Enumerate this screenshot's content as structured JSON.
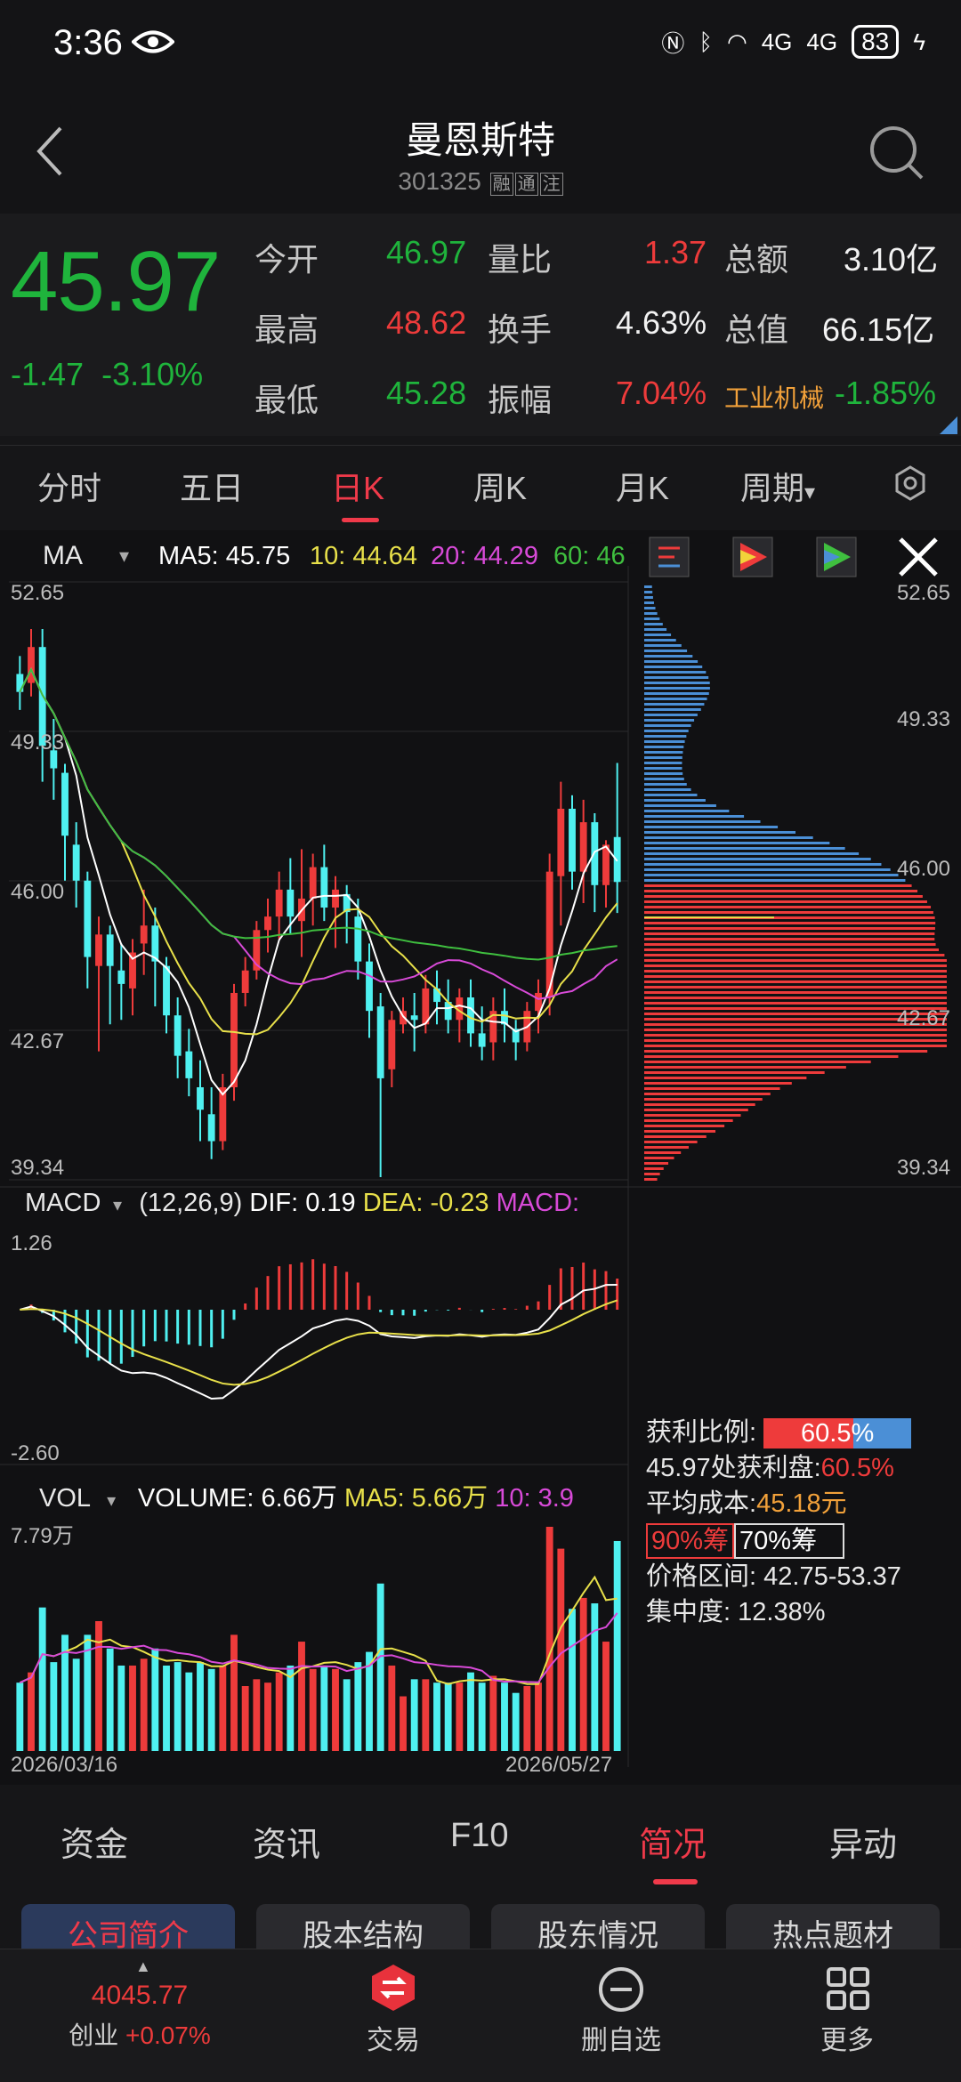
{
  "status_bar": {
    "time": "3:36",
    "net": "4G",
    "battery": "83"
  },
  "header": {
    "title": "曼恩斯特",
    "code": "301325",
    "tags": [
      "融",
      "通",
      "注"
    ]
  },
  "quote": {
    "price": "45.97",
    "change": "-1.47",
    "change_pct": "-3.10%",
    "rows": [
      [
        {
          "l": "今开",
          "v": "46.97",
          "c": "g"
        },
        {
          "l": "量比",
          "v": "1.37",
          "c": "r"
        },
        {
          "l": "总额",
          "v": "3.10亿",
          "c": "w"
        }
      ],
      [
        {
          "l": "最高",
          "v": "48.62",
          "c": "r"
        },
        {
          "l": "换手",
          "v": "4.63%",
          "c": "w"
        },
        {
          "l": "总值",
          "v": "66.15亿",
          "c": "w"
        }
      ],
      [
        {
          "l": "最低",
          "v": "45.28",
          "c": "g"
        },
        {
          "l": "振幅",
          "v": "7.04%",
          "c": "r"
        },
        {
          "l": "工业机械",
          "v": "-1.85%",
          "c": "g"
        }
      ]
    ]
  },
  "period_tabs": [
    "分时",
    "五日",
    "日K",
    "周K",
    "月K",
    "周期"
  ],
  "active_period": "日K",
  "ma_legend": {
    "name": "MA",
    "ma5": "MA5: 45.75",
    "ma10": "10: 44.64",
    "ma20": "20: 44.29",
    "ma60": "60: 46"
  },
  "price_axis": [
    "52.65",
    "49.33",
    "46.00",
    "42.67",
    "39.34"
  ],
  "macd_legend": {
    "name": "MACD",
    "params": "(12,26,9)",
    "dif": "DIF: 0.19",
    "dea": "DEA: -0.23",
    "macd": "MACD:"
  },
  "macd_axis": [
    "1.26",
    "-2.60"
  ],
  "vol_legend": {
    "name": "VOL",
    "volume": "VOLUME: 6.66万",
    "ma5": "MA5: 5.66万",
    "ma10": "10: 3.9"
  },
  "vol_axis": [
    "7.79万"
  ],
  "date_range": {
    "start": "2026/03/16",
    "end": "2026/05/27"
  },
  "chips_info": {
    "profit_ratio_label": "获利比例:",
    "profit_ratio": "60.5%",
    "profit_at_label": "45.97处获利盘:",
    "profit_at": "60.5%",
    "avg_cost_label": "平均成本:",
    "avg_cost": "45.18元",
    "btn90": "90%筹",
    "btn70": "70%筹",
    "range_label": "价格区间:",
    "range": "42.75-53.37",
    "conc_label": "集中度:",
    "conc": "12.38%"
  },
  "bottom_tabs": [
    "资金",
    "资讯",
    "F10",
    "简况",
    "异动"
  ],
  "active_bottom": "简况",
  "sub_tabs": [
    "公司简介",
    "股本结构",
    "股东情况",
    "热点题材"
  ],
  "dock": {
    "index_value": "4045.77",
    "index_name": "创业",
    "index_change": "+0.07%",
    "trade": "交易",
    "remove_fav": "删自选",
    "more": "更多"
  },
  "colors": {
    "up": "#ee3b3b",
    "down": "#4ff0f0",
    "ma5": "#ffffff",
    "ma10": "#e8e04a",
    "ma20": "#d84ad8",
    "ma60": "#3fbf3f",
    "accent": "#f03a4a"
  },
  "chart_data": {
    "type": "candlestick",
    "y_range": [
      39.34,
      52.65
    ],
    "candles": [
      [
        50.6,
        51.0,
        49.8,
        50.2
      ],
      [
        50.4,
        51.6,
        50.1,
        51.2
      ],
      [
        51.2,
        51.6,
        48.2,
        49.0
      ],
      [
        48.9,
        49.6,
        47.8,
        48.5
      ],
      [
        48.4,
        48.6,
        46.0,
        47.0
      ],
      [
        46.8,
        47.3,
        45.4,
        46.0
      ],
      [
        46.0,
        46.2,
        43.6,
        44.3
      ],
      [
        44.1,
        45.2,
        42.2,
        44.8
      ],
      [
        44.8,
        45.0,
        42.8,
        44.1
      ],
      [
        44.0,
        44.6,
        42.9,
        43.7
      ],
      [
        43.6,
        44.7,
        43.0,
        44.4
      ],
      [
        44.6,
        45.8,
        43.9,
        45.0
      ],
      [
        45.0,
        45.4,
        43.2,
        44.2
      ],
      [
        44.1,
        44.3,
        42.6,
        43.0
      ],
      [
        43.0,
        43.4,
        41.6,
        42.1
      ],
      [
        42.2,
        42.7,
        41.2,
        41.6
      ],
      [
        41.4,
        42.0,
        40.2,
        40.9
      ],
      [
        40.8,
        41.4,
        39.8,
        40.2
      ],
      [
        40.2,
        41.7,
        40.0,
        41.4
      ],
      [
        41.4,
        43.7,
        41.1,
        43.5
      ],
      [
        43.5,
        44.3,
        43.2,
        44.0
      ],
      [
        44.0,
        45.1,
        43.8,
        44.9
      ],
      [
        44.9,
        45.6,
        44.4,
        45.2
      ],
      [
        45.2,
        46.2,
        44.7,
        45.8
      ],
      [
        45.8,
        46.5,
        44.8,
        45.2
      ],
      [
        45.1,
        46.7,
        44.3,
        45.6
      ],
      [
        45.6,
        46.6,
        45.0,
        46.3
      ],
      [
        46.3,
        46.8,
        45.1,
        45.4
      ],
      [
        45.4,
        46.1,
        44.5,
        45.8
      ],
      [
        45.7,
        45.9,
        44.6,
        45.3
      ],
      [
        45.2,
        45.6,
        43.8,
        44.2
      ],
      [
        44.2,
        44.6,
        42.5,
        43.1
      ],
      [
        43.2,
        43.5,
        39.4,
        41.6
      ],
      [
        41.8,
        43.1,
        41.4,
        42.9
      ],
      [
        42.8,
        43.4,
        42.6,
        43.1
      ],
      [
        43.0,
        43.5,
        42.2,
        42.9
      ],
      [
        42.8,
        43.9,
        42.6,
        43.6
      ],
      [
        43.6,
        44.0,
        42.8,
        43.3
      ],
      [
        43.3,
        43.8,
        42.6,
        42.9
      ],
      [
        42.9,
        43.6,
        42.4,
        43.4
      ],
      [
        43.4,
        43.8,
        42.3,
        42.6
      ],
      [
        42.6,
        43.2,
        42.0,
        42.3
      ],
      [
        42.4,
        43.4,
        42.0,
        43.1
      ],
      [
        43.1,
        43.6,
        42.4,
        42.8
      ],
      [
        42.7,
        42.9,
        42.0,
        42.4
      ],
      [
        42.4,
        43.3,
        42.2,
        43.1
      ],
      [
        43.1,
        43.8,
        42.6,
        43.5
      ],
      [
        43.4,
        46.6,
        43.0,
        46.2
      ],
      [
        46.1,
        48.2,
        45.0,
        47.6
      ],
      [
        47.6,
        47.9,
        45.8,
        46.2
      ],
      [
        46.2,
        47.8,
        45.5,
        47.3
      ],
      [
        47.3,
        47.5,
        45.3,
        45.9
      ],
      [
        45.9,
        46.9,
        45.4,
        46.8
      ],
      [
        46.97,
        48.62,
        45.28,
        45.97
      ]
    ]
  }
}
